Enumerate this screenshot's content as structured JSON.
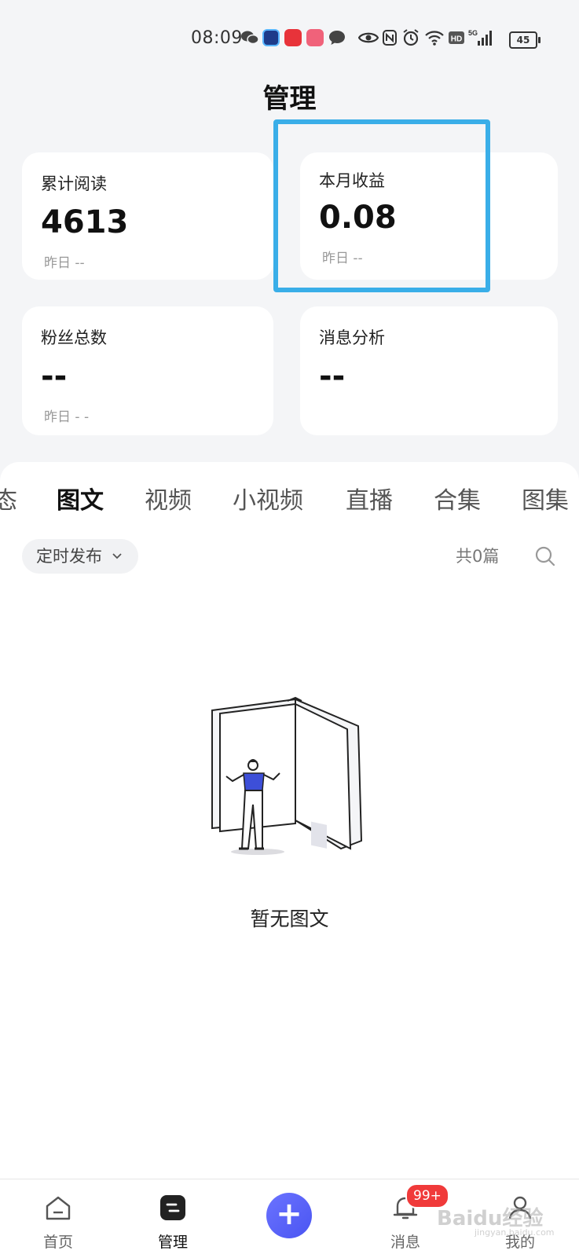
{
  "status_bar": {
    "time": "08:09",
    "battery": "45",
    "icons": [
      "wechat-icon",
      "app-icon-blue",
      "app-icon-red",
      "app-icon-swan",
      "message-bubble-icon",
      "eye-icon",
      "nfc-icon",
      "alarm-icon",
      "wifi-icon",
      "hd-icon",
      "signal-5g-icon",
      "battery-icon"
    ]
  },
  "header": {
    "title": "管理"
  },
  "stats": {
    "total_reads": {
      "label": "累计阅读",
      "value": "4613",
      "sub": "昨日 --"
    },
    "month_income": {
      "label": "本月收益",
      "value": "0.08",
      "sub": "昨日 --"
    },
    "fans_total": {
      "label": "粉丝总数",
      "value": "--",
      "sub": "昨日 - -"
    },
    "msg_analysis": {
      "label": "消息分析",
      "value": "--"
    }
  },
  "tabs": [
    {
      "label": "态"
    },
    {
      "label": "图文",
      "active": true
    },
    {
      "label": "视频"
    },
    {
      "label": "小视频"
    },
    {
      "label": "直播"
    },
    {
      "label": "合集"
    },
    {
      "label": "图集"
    }
  ],
  "filter": {
    "label": "定时发布",
    "count": "共0篇"
  },
  "empty_state": {
    "text": "暂无图文"
  },
  "bottom_nav": {
    "home": "首页",
    "manage": "管理",
    "add": "+",
    "messages": "消息",
    "messages_badge": "99+",
    "mine": "我的"
  },
  "watermark": {
    "brand": "Baidu经验",
    "url": "jingyan.baidu.com"
  },
  "colors": {
    "highlight": "#3aaee8",
    "fab": "#5560f5",
    "badge": "#f03a3a",
    "figure_shirt": "#3d4fd8"
  }
}
